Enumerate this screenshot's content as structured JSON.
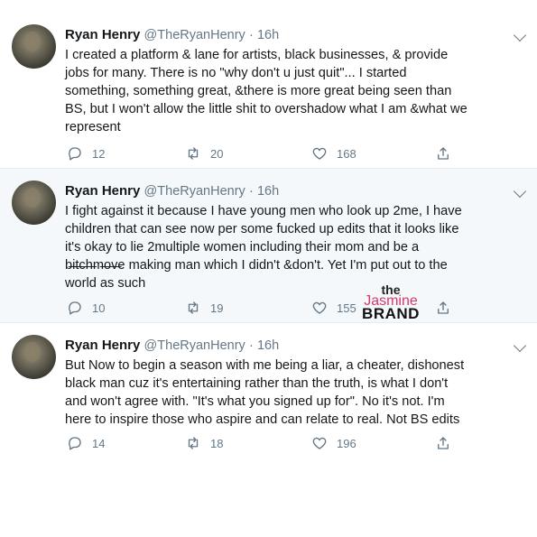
{
  "tweets": [
    {
      "name": "Ryan Henry",
      "handle": "@TheRyanHenry",
      "separator": "·",
      "time": "16h",
      "lines": [
        "I created a platform & lane for artists, black businesses, & provide",
        "jobs for many. There is no \"why don't u just quit\"... I started",
        "something, something great, &there is more great being seen than",
        "BS, but I won't allow the little shit to overshadow what I am &what we",
        "represent"
      ],
      "replies": "12",
      "retweets": "20",
      "likes": "168"
    },
    {
      "name": "Ryan Henry",
      "handle": "@TheRyanHenry",
      "separator": "·",
      "time": "16h",
      "lines": [
        "I fight against it because I have young men who look up 2me, I have",
        "children that can see now per some fucked up edits that it looks like",
        "it's okay to lie 2multiple women including their mom and be a",
        "b̶i̶t̶c̶h̶m̶o̶v̶e making man which I didn't &don't. Yet I'm put out to the",
        "world as such"
      ],
      "replies": "10",
      "retweets": "19",
      "likes": "155"
    },
    {
      "name": "Ryan Henry",
      "handle": "@TheRyanHenry",
      "separator": "·",
      "time": "16h",
      "lines": [
        "But  Now to begin a season with me being a liar, a cheater, dishonest",
        "black man cuz it's entertaining rather than the truth, is what I don't",
        "and won't agree with. \"It's what you signed up for\". No it's not. I'm",
        "here to inspire those who aspire and can relate to real. Not BS edits"
      ],
      "replies": "14",
      "retweets": "18",
      "likes": "196"
    }
  ],
  "watermark": {
    "line1": "the",
    "line2": "Jasmine",
    "line3": "BRAND"
  },
  "icons": {
    "reply": "speech-bubble-icon",
    "retweet": "retweet-arrows-icon",
    "like": "heart-icon",
    "share": "share-upload-icon",
    "menu": "chevron-down-icon"
  }
}
